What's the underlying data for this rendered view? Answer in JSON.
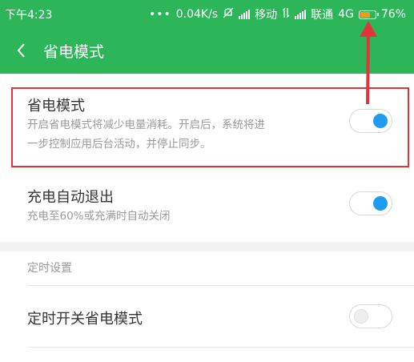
{
  "status_bar": {
    "time": "下午4:23",
    "dots": "•••",
    "speed": "0.04K/s",
    "carrier1": "移动",
    "carrier2": "联通",
    "network": "4G",
    "battery": "76%",
    "battery_level": 0.76,
    "battery_fill_color": "#f39a1d"
  },
  "header": {
    "title": "省电模式",
    "background_color": "#2db55a",
    "back_icon": "chevron-left-icon"
  },
  "settings": {
    "power_saving": {
      "title": "省电模式",
      "desc_line1": "开启省电模式将减少电量消耗。开启后，系统将进",
      "desc_line2": "一步控制应用后台活动，并停止同步。",
      "enabled": true
    },
    "charging_auto_exit": {
      "title": "充电自动退出",
      "desc": "充电至60%或充满时自动关闭",
      "enabled": true
    },
    "schedule_header": "定时设置",
    "scheduled_toggle": {
      "title": "定时开关省电模式",
      "enabled": false
    }
  },
  "colors": {
    "toggle_on": "#1e9cef",
    "annotation_red": "#e2343a"
  }
}
